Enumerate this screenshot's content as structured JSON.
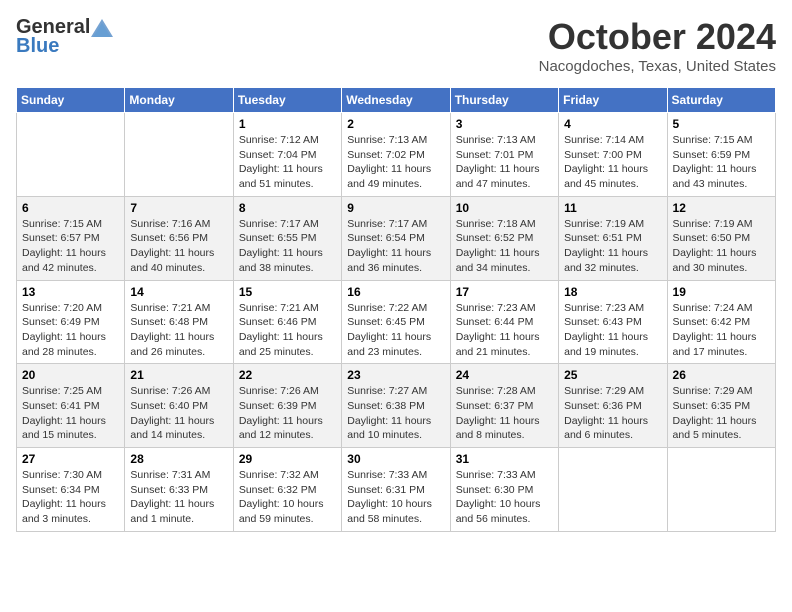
{
  "header": {
    "logo_general": "General",
    "logo_blue": "Blue",
    "month": "October 2024",
    "location": "Nacogdoches, Texas, United States"
  },
  "days_of_week": [
    "Sunday",
    "Monday",
    "Tuesday",
    "Wednesday",
    "Thursday",
    "Friday",
    "Saturday"
  ],
  "weeks": [
    [
      {
        "day": "",
        "info": ""
      },
      {
        "day": "",
        "info": ""
      },
      {
        "day": "1",
        "info": "Sunrise: 7:12 AM\nSunset: 7:04 PM\nDaylight: 11 hours and 51 minutes."
      },
      {
        "day": "2",
        "info": "Sunrise: 7:13 AM\nSunset: 7:02 PM\nDaylight: 11 hours and 49 minutes."
      },
      {
        "day": "3",
        "info": "Sunrise: 7:13 AM\nSunset: 7:01 PM\nDaylight: 11 hours and 47 minutes."
      },
      {
        "day": "4",
        "info": "Sunrise: 7:14 AM\nSunset: 7:00 PM\nDaylight: 11 hours and 45 minutes."
      },
      {
        "day": "5",
        "info": "Sunrise: 7:15 AM\nSunset: 6:59 PM\nDaylight: 11 hours and 43 minutes."
      }
    ],
    [
      {
        "day": "6",
        "info": "Sunrise: 7:15 AM\nSunset: 6:57 PM\nDaylight: 11 hours and 42 minutes."
      },
      {
        "day": "7",
        "info": "Sunrise: 7:16 AM\nSunset: 6:56 PM\nDaylight: 11 hours and 40 minutes."
      },
      {
        "day": "8",
        "info": "Sunrise: 7:17 AM\nSunset: 6:55 PM\nDaylight: 11 hours and 38 minutes."
      },
      {
        "day": "9",
        "info": "Sunrise: 7:17 AM\nSunset: 6:54 PM\nDaylight: 11 hours and 36 minutes."
      },
      {
        "day": "10",
        "info": "Sunrise: 7:18 AM\nSunset: 6:52 PM\nDaylight: 11 hours and 34 minutes."
      },
      {
        "day": "11",
        "info": "Sunrise: 7:19 AM\nSunset: 6:51 PM\nDaylight: 11 hours and 32 minutes."
      },
      {
        "day": "12",
        "info": "Sunrise: 7:19 AM\nSunset: 6:50 PM\nDaylight: 11 hours and 30 minutes."
      }
    ],
    [
      {
        "day": "13",
        "info": "Sunrise: 7:20 AM\nSunset: 6:49 PM\nDaylight: 11 hours and 28 minutes."
      },
      {
        "day": "14",
        "info": "Sunrise: 7:21 AM\nSunset: 6:48 PM\nDaylight: 11 hours and 26 minutes."
      },
      {
        "day": "15",
        "info": "Sunrise: 7:21 AM\nSunset: 6:46 PM\nDaylight: 11 hours and 25 minutes."
      },
      {
        "day": "16",
        "info": "Sunrise: 7:22 AM\nSunset: 6:45 PM\nDaylight: 11 hours and 23 minutes."
      },
      {
        "day": "17",
        "info": "Sunrise: 7:23 AM\nSunset: 6:44 PM\nDaylight: 11 hours and 21 minutes."
      },
      {
        "day": "18",
        "info": "Sunrise: 7:23 AM\nSunset: 6:43 PM\nDaylight: 11 hours and 19 minutes."
      },
      {
        "day": "19",
        "info": "Sunrise: 7:24 AM\nSunset: 6:42 PM\nDaylight: 11 hours and 17 minutes."
      }
    ],
    [
      {
        "day": "20",
        "info": "Sunrise: 7:25 AM\nSunset: 6:41 PM\nDaylight: 11 hours and 15 minutes."
      },
      {
        "day": "21",
        "info": "Sunrise: 7:26 AM\nSunset: 6:40 PM\nDaylight: 11 hours and 14 minutes."
      },
      {
        "day": "22",
        "info": "Sunrise: 7:26 AM\nSunset: 6:39 PM\nDaylight: 11 hours and 12 minutes."
      },
      {
        "day": "23",
        "info": "Sunrise: 7:27 AM\nSunset: 6:38 PM\nDaylight: 11 hours and 10 minutes."
      },
      {
        "day": "24",
        "info": "Sunrise: 7:28 AM\nSunset: 6:37 PM\nDaylight: 11 hours and 8 minutes."
      },
      {
        "day": "25",
        "info": "Sunrise: 7:29 AM\nSunset: 6:36 PM\nDaylight: 11 hours and 6 minutes."
      },
      {
        "day": "26",
        "info": "Sunrise: 7:29 AM\nSunset: 6:35 PM\nDaylight: 11 hours and 5 minutes."
      }
    ],
    [
      {
        "day": "27",
        "info": "Sunrise: 7:30 AM\nSunset: 6:34 PM\nDaylight: 11 hours and 3 minutes."
      },
      {
        "day": "28",
        "info": "Sunrise: 7:31 AM\nSunset: 6:33 PM\nDaylight: 11 hours and 1 minute."
      },
      {
        "day": "29",
        "info": "Sunrise: 7:32 AM\nSunset: 6:32 PM\nDaylight: 10 hours and 59 minutes."
      },
      {
        "day": "30",
        "info": "Sunrise: 7:33 AM\nSunset: 6:31 PM\nDaylight: 10 hours and 58 minutes."
      },
      {
        "day": "31",
        "info": "Sunrise: 7:33 AM\nSunset: 6:30 PM\nDaylight: 10 hours and 56 minutes."
      },
      {
        "day": "",
        "info": ""
      },
      {
        "day": "",
        "info": ""
      }
    ]
  ]
}
